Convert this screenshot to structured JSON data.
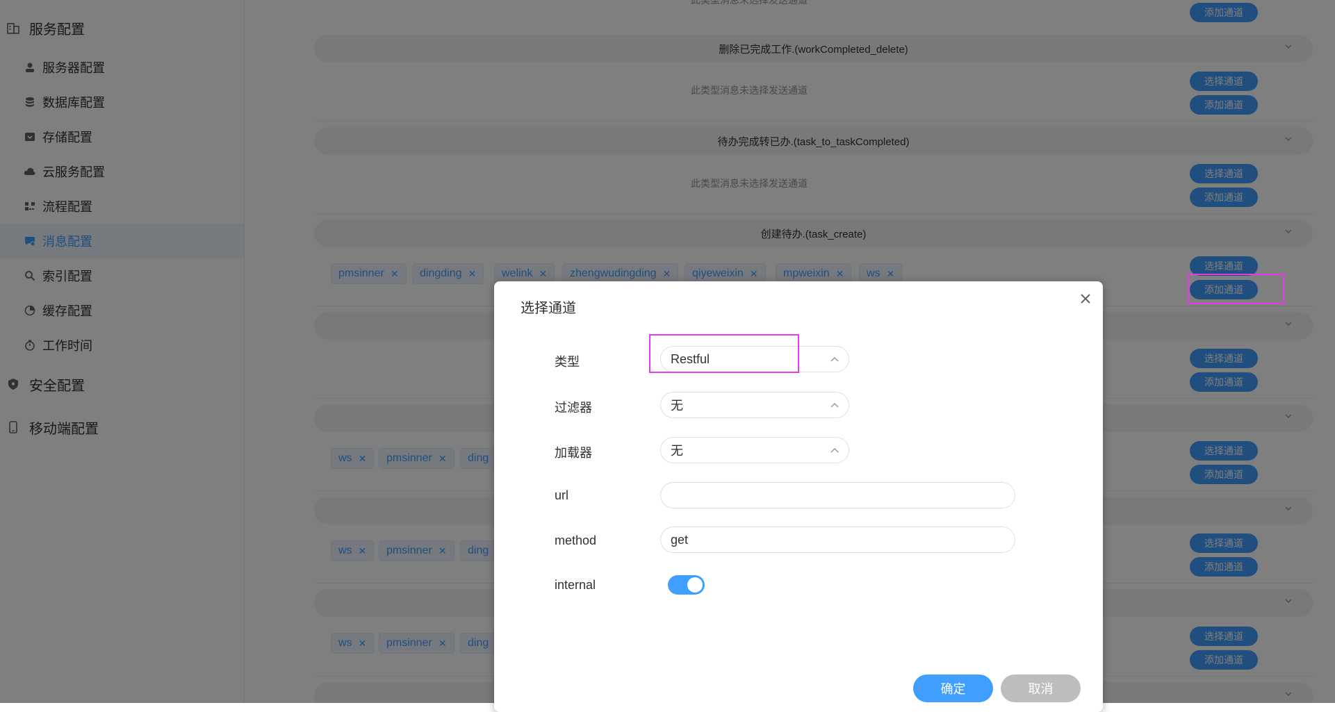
{
  "sidebar": {
    "groups": [
      {
        "label": "服务配置",
        "icon": "building-icon"
      },
      {
        "label": "安全配置",
        "icon": "shield-icon"
      },
      {
        "label": "移动端配置",
        "icon": "mobile-icon"
      }
    ],
    "items": [
      {
        "label": "服务器配置",
        "icon": "server-user-icon"
      },
      {
        "label": "数据库配置",
        "icon": "database-icon"
      },
      {
        "label": "存储配置",
        "icon": "storage-icon"
      },
      {
        "label": "云服务配置",
        "icon": "cloud-icon"
      },
      {
        "label": "流程配置",
        "icon": "flow-icon"
      },
      {
        "label": "消息配置",
        "icon": "message-icon",
        "active": true
      },
      {
        "label": "索引配置",
        "icon": "search-icon"
      },
      {
        "label": "缓存配置",
        "icon": "pie-icon"
      },
      {
        "label": "工作时间",
        "icon": "stopwatch-icon"
      }
    ]
  },
  "main": {
    "top_partial_hint": "此类型消息未选择发送通道",
    "sections": [
      {
        "title": "删除已完成工作.(workCompleted_delete)",
        "hint": "此类型消息未选择发送通道"
      },
      {
        "title": "待办完成转已办.(task_to_taskCompleted)",
        "hint": "此类型消息未选择发送通道"
      },
      {
        "title": "创建待办.(task_create)",
        "tags": [
          "pmsinner",
          "dingding",
          "welink",
          "zhengwudingding",
          "qiyeweixin",
          "mpweixin",
          "ws"
        ]
      }
    ],
    "lower_tags": [
      "ws",
      "pmsinner",
      "ding"
    ],
    "select_channel_label": "选择通道",
    "add_channel_label": "添加通道"
  },
  "dialog": {
    "title": "选择通道",
    "fields": {
      "type": {
        "label": "类型",
        "value": "Restful"
      },
      "filter": {
        "label": "过滤器",
        "value": "无"
      },
      "loader": {
        "label": "加载器",
        "value": "无"
      },
      "url": {
        "label": "url",
        "value": ""
      },
      "method": {
        "label": "method",
        "value": "get"
      },
      "internal": {
        "label": "internal",
        "value": true
      }
    },
    "confirm_label": "确定",
    "cancel_label": "取消"
  },
  "colors": {
    "accent": "#409eff",
    "annotation": "#e83aed",
    "cancel_button": "#bdbdbd"
  }
}
